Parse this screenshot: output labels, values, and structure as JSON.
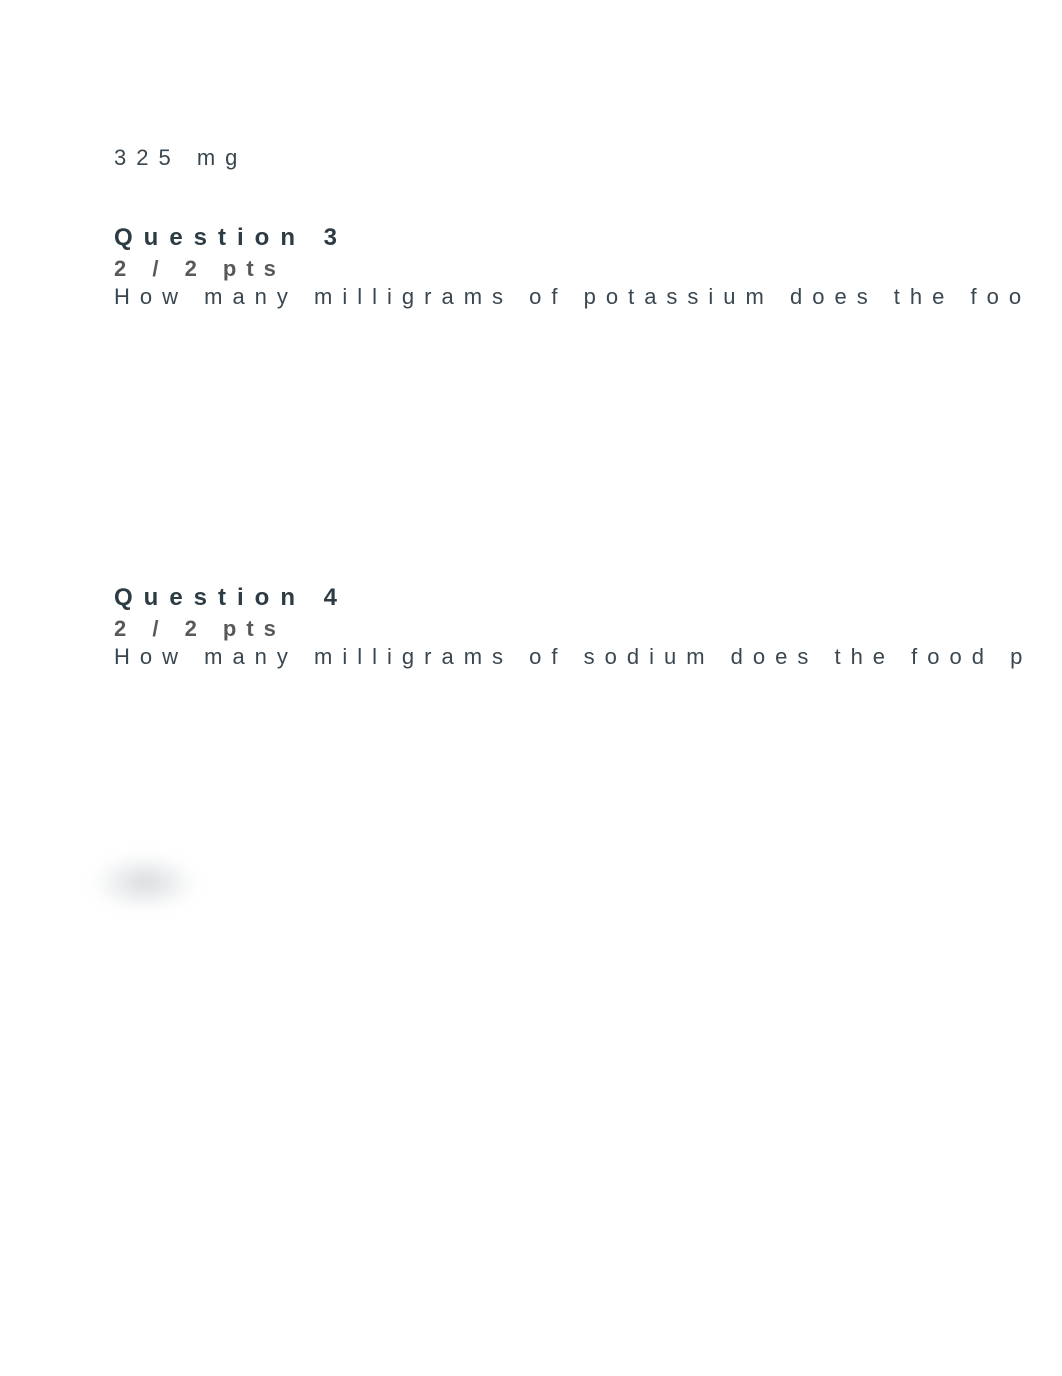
{
  "answer_top": "325 mg",
  "questions": [
    {
      "title": "Question 3",
      "pts": "2 / 2 pts",
      "body": "How many milligrams of potassium does the foo"
    },
    {
      "title": "Question 4",
      "pts": "2 / 2 pts",
      "body": "How many milligrams of sodium does the food p"
    }
  ]
}
